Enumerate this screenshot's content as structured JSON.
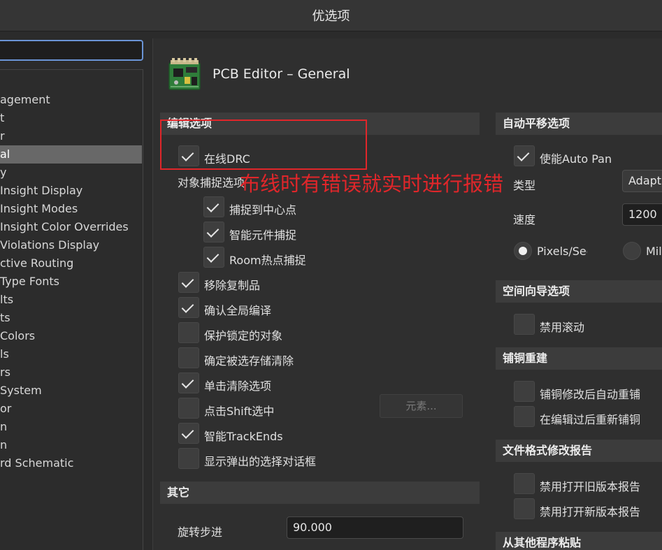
{
  "window": {
    "title": "优选项"
  },
  "tree": {
    "items": [
      {
        "label": "agement"
      },
      {
        "label": "t"
      },
      {
        "label": "r"
      },
      {
        "label": "al",
        "selected": true
      },
      {
        "label": "y"
      },
      {
        "label": " Insight Display"
      },
      {
        "label": " Insight Modes"
      },
      {
        "label": " Insight Color Overrides"
      },
      {
        "label": "Violations Display"
      },
      {
        "label": "ctive Routing"
      },
      {
        "label": "Type Fonts"
      },
      {
        "label": "lts"
      },
      {
        "label": "ts"
      },
      {
        "label": "Colors"
      },
      {
        "label": "ls"
      },
      {
        "label": "rs"
      },
      {
        "label": "System"
      },
      {
        "label": "or"
      },
      {
        "label": "n"
      },
      {
        "label": "n"
      },
      {
        "label": "rd Schematic"
      }
    ]
  },
  "page": {
    "title": "PCB Editor – General"
  },
  "edit_options": {
    "header": "编辑选项",
    "online_drc": "在线DRC",
    "snap_group": "对象捕捉选项",
    "snap_center": "捕捉到中心点",
    "smart_component_snap": "智能元件捕捉",
    "room_hotspot_snap": "Room热点捕捉",
    "remove_duplicates": "移除复制品",
    "confirm_global_edit": "确认全局编译",
    "protect_locked": "保护锁定的对象",
    "confirm_selection_clear": "确定被选存储清除",
    "click_clear_selection": "单击清除选项",
    "shift_click_select": "点击Shift选中",
    "elements_button": "元素...",
    "smart_track_ends": "智能TrackEnds",
    "show_popup_dialog": "显示弹出的选择对话框"
  },
  "other": {
    "header": "其它",
    "rotation_step_label": "旋转步进",
    "rotation_step_value": "90.000"
  },
  "autopan": {
    "header": "自动平移选项",
    "enable": "使能Auto Pan",
    "type_label": "类型",
    "type_value": "Adaptive",
    "speed_label": "速度",
    "speed_value": "1200",
    "unit_pixels": "Pixels/Sec",
    "unit_mils": "Mils/Sec"
  },
  "space_nav": {
    "header": "空间向导选项",
    "disable_scroll": "禁用滚动"
  },
  "repour": {
    "header": "铺铜重建",
    "auto_repour": "铺铜修改后自动重铺",
    "repour_after_edit": "在编辑过后重新铺铜"
  },
  "file_format": {
    "header": "文件格式修改报告",
    "disable_old": "禁用打开旧版本报告",
    "disable_new": "禁用打开新版本报告"
  },
  "paste": {
    "header": "从其他程序粘贴"
  },
  "annotation": {
    "text": "布线时有错误就实时进行报错"
  },
  "colors": {
    "accent_red": "#e0262a",
    "focus_blue": "#6a94d6"
  }
}
